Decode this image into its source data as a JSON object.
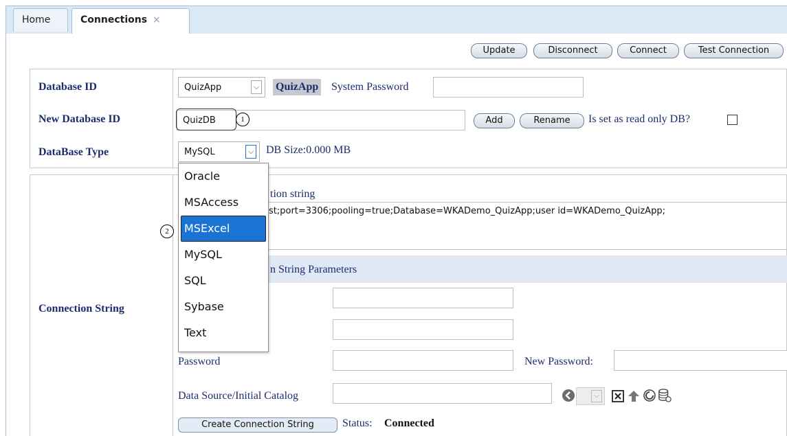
{
  "tabs": [
    {
      "label": "Home"
    },
    {
      "label": "Connections",
      "close": "×"
    }
  ],
  "toolbar": {
    "update": "Update",
    "disconnect": "Disconnect",
    "connect": "Connect",
    "test": "Test Connection"
  },
  "form": {
    "database_id_label": "Database ID",
    "database_id_value": "QuizApp",
    "database_id_badge": "QuizApp",
    "system_password_label": "System Password",
    "new_database_id_label": "New Database ID",
    "new_database_id_value": "QuizDB",
    "add": "Add",
    "rename": "Rename",
    "readonly_label": "Is set as read only DB?",
    "database_type_label": "DataBase Type",
    "database_type_value": "MySQL",
    "db_size": "DB Size:0.000 MB"
  },
  "dropdown": {
    "options": [
      "Oracle",
      "MSAccess",
      "MSExcel",
      "MySQL",
      "SQL",
      "Sybase",
      "Text"
    ],
    "highlighted": "MSExcel"
  },
  "connection": {
    "section_label": "Connection String",
    "conn_string_heading_visible": "tion string",
    "conn_string_value_visible": "st;port=3306;pooling=true;Database=WKADemo_QuizApp;user id=WKADemo_QuizApp;",
    "params_heading_visible": "n String Parameters",
    "password_label": "Password",
    "new_password_label": "New Password:",
    "data_source_label": "Data Source/Initial Catalog",
    "create_button": "Create Connection String",
    "status_label": "Status:",
    "status_value": "Connected"
  },
  "callouts": {
    "one": "1",
    "two": "2"
  }
}
